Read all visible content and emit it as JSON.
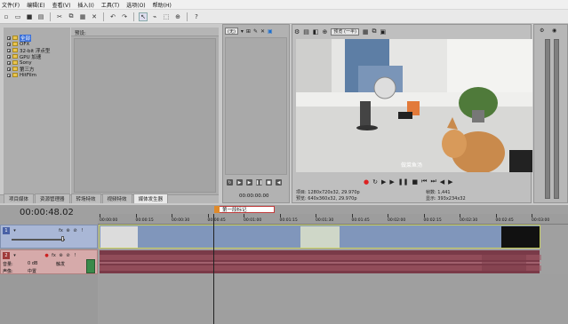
{
  "menu": [
    "文件(F)",
    "编辑(E)",
    "查看(V)",
    "插入(I)",
    "工具(T)",
    "选项(O)",
    "帮助(H)"
  ],
  "explorer": {
    "items": [
      {
        "label": "全部",
        "selected": true
      },
      {
        "label": "OFX",
        "selected": false
      },
      {
        "label": "32-bit 浮点型",
        "selected": false
      },
      {
        "label": "GPU 加速",
        "selected": false
      },
      {
        "label": "Sony",
        "selected": false
      },
      {
        "label": "第三方",
        "selected": false
      },
      {
        "label": "HitFilm",
        "selected": false
      }
    ]
  },
  "effects_header": "预设:",
  "bottom_tabs": [
    {
      "label": "项目媒体",
      "active": false
    },
    {
      "label": "资源管理器",
      "active": false
    },
    {
      "label": "转场特效",
      "active": false
    },
    {
      "label": "视频特效",
      "active": false
    },
    {
      "label": "媒体发生器",
      "active": true
    }
  ],
  "trimmer": {
    "dropdown": "(无)",
    "time": "00:00:00.00"
  },
  "preview": {
    "quality": "预览 (一半)",
    "subtitle": "做菜鱼汤",
    "info_left_1": "项目: 1280x720x32, 29.970p",
    "info_left_2": "预览: 640x360x32, 29.970p",
    "info_right_1": "帧数: 1,441",
    "info_right_2": "显示: 393x234x32"
  },
  "timeline": {
    "timecode": "00:00:48.02",
    "region_label": "第一段标记",
    "ruler_ticks": [
      "00:00:00",
      "00:00:15",
      "00:00:30",
      "00:00:45",
      "00:01:00",
      "00:01:15",
      "00:01:30",
      "00:01:45",
      "00:02:00",
      "00:02:15",
      "00:02:30",
      "00:02:45",
      "00:03:00"
    ],
    "cursor_time": "00:00:48",
    "video_track": {
      "number": "1"
    },
    "audio_track": {
      "number": "2",
      "volume_label": "音量:",
      "volume_value": "0 dB",
      "pan_label": "声像:",
      "pan_value": "中置",
      "touch_label": "触发"
    }
  },
  "colors": {
    "video_track": "#8096bb",
    "audio_track": "#7a3a48",
    "accent": "#3a6fd8"
  }
}
